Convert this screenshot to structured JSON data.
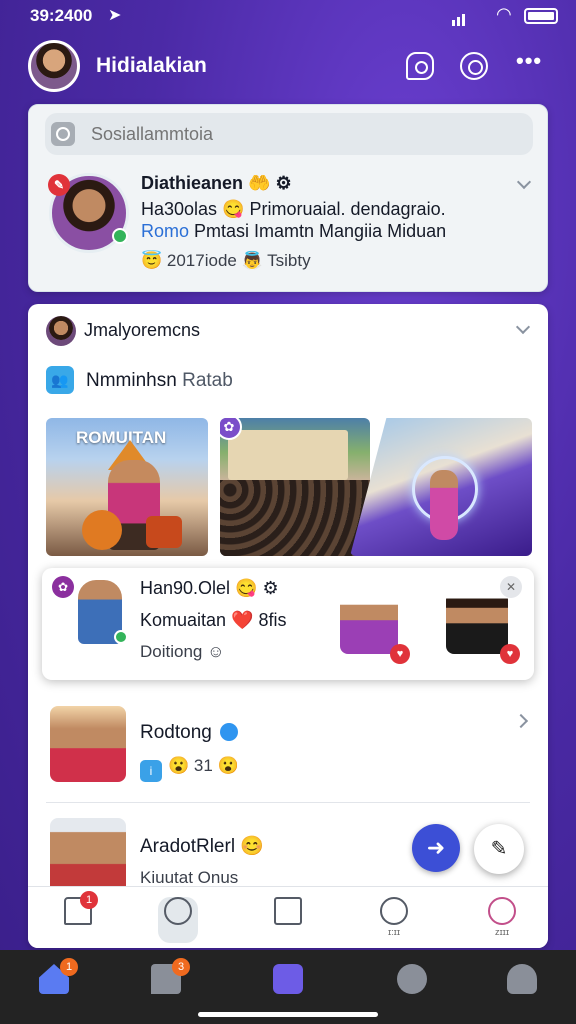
{
  "status_bar": {
    "time": "39:2400"
  },
  "header": {
    "title": "Hidialakian"
  },
  "search": {
    "placeholder": "Sosiallammtoia"
  },
  "post": {
    "author": "Diathieanen",
    "line1": "Ha30olas 😋 Primoruaial. dendagraio.",
    "line2_tag": "Romo",
    "line2_text": " Pmtasi Imamtn Mangiia Miduan",
    "meta": "😇 2017iode  👼 Tsibty"
  },
  "feed": {
    "author": "Jmalyoremcns",
    "group_label": "Nmminhsn",
    "group_sub": "Ratab",
    "photo_text": "ROMUITAN",
    "subcard": {
      "title": "Han90.Olel 😋",
      "line": "Komuaitan ❤️  8fis",
      "meta": "Doitiong"
    },
    "rows": [
      {
        "title": "Rodtong",
        "sub": "31"
      },
      {
        "title": "AradotRlerl 😊",
        "sub": "Kiuutat Onus"
      }
    ]
  },
  "inner_nav": {
    "items": [
      {
        "name": "home",
        "caption": "",
        "badge": "1"
      },
      {
        "name": "search",
        "caption": "",
        "badge": ""
      },
      {
        "name": "send",
        "caption": "",
        "badge": ""
      },
      {
        "name": "download",
        "caption": "ɪ:ɪɪ",
        "badge": ""
      },
      {
        "name": "profile",
        "caption": "zɪɪɪ",
        "badge": ""
      }
    ]
  },
  "bottom_nav": {
    "home_badge": "1",
    "msg_badge": "3"
  },
  "colors": {
    "accent": "#6d5ce6",
    "background": "#4b2aa6",
    "badge_red": "#e0333a"
  }
}
